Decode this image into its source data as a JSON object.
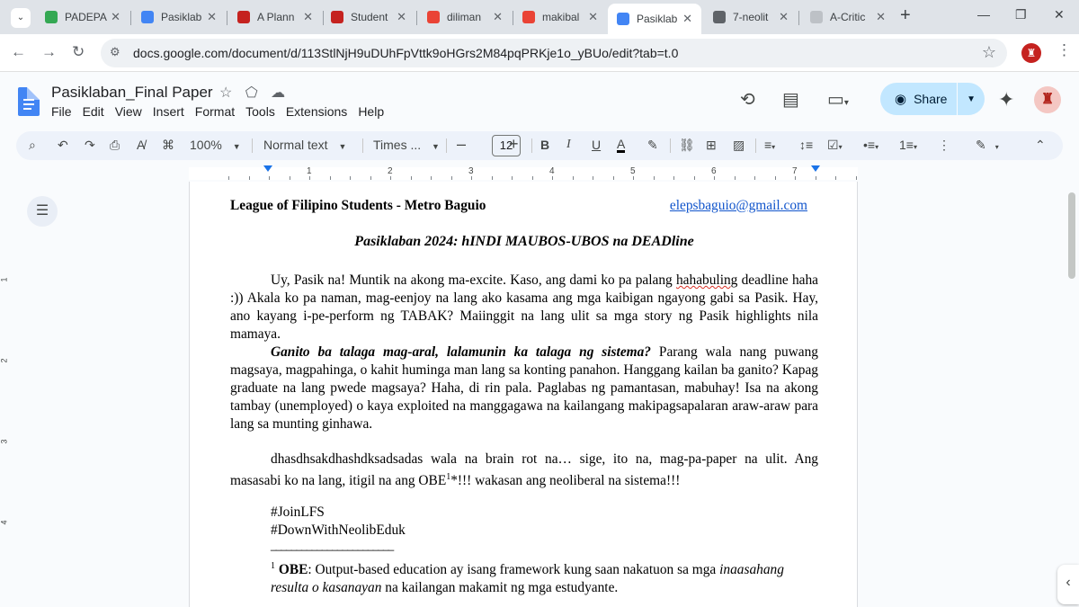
{
  "browser": {
    "tabs": [
      {
        "title": "PADEPA",
        "favicon_color": "#34a853"
      },
      {
        "title": "Pasiklab",
        "favicon_color": "#4285f4"
      },
      {
        "title": "A Plann",
        "favicon_color": "#c5221f"
      },
      {
        "title": "Student",
        "favicon_color": "#c5221f"
      },
      {
        "title": "diliman",
        "favicon_color": "#ea4335"
      },
      {
        "title": "makibal",
        "favicon_color": "#ea4335"
      },
      {
        "title": "Pasiklab",
        "favicon_color": "#4285f4"
      },
      {
        "title": "7-neolit",
        "favicon_color": "#5f6368"
      },
      {
        "title": "A-Critic",
        "favicon_color": "#bdc1c6"
      }
    ],
    "url": "docs.google.com/document/d/113StlNjH9uDUhFpVttk9oHGrs2M84pqPRKje1o_yBUo/edit?tab=t.0"
  },
  "docs": {
    "title": "Pasiklaban_Final Paper",
    "menu": [
      "File",
      "Edit",
      "View",
      "Insert",
      "Format",
      "Tools",
      "Extensions",
      "Help"
    ],
    "share_label": "Share",
    "toolbar": {
      "zoom": "100%",
      "style": "Normal text",
      "font": "Times ...",
      "font_size": "12"
    },
    "ruler_numbers": [
      "1",
      "2",
      "3",
      "4",
      "5",
      "6",
      "7"
    ],
    "vruler_numbers": [
      "1",
      "2",
      "3",
      "4"
    ]
  },
  "document": {
    "org": "League of Filipino Students - Metro Baguio",
    "email": "elepsbaguio@gmail.com",
    "heading": "Pasiklaban 2024: hINDI MAUBOS-UBOS na DEADline",
    "p1_before": "Uy, Pasik na! Muntik na akong ma-excite. Kaso, ang dami ko pa palang ",
    "p1_spell": "hahabuling",
    "p1_after": " deadline haha :)) Akala ko pa naman, mag-eenjoy na lang ako kasama ang mga kaibigan ngayong gabi sa Pasik. Hay, ano kayang i-pe-perform ng TABAK? Maiinggit na lang ulit sa mga story ng Pasik highlights nila mamaya.",
    "p2_bold": "Ganito ba talaga mag-aral, lalamunin ka talaga ng sistema?",
    "p2_rest": " Parang wala nang puwang magsaya, magpahinga, o kahit huminga man lang sa konting panahon. Hanggang kailan ba ganito? Kapag graduate na lang pwede magsaya? Haha, di rin pala. Paglabas ng pamantasan, mabuhay! Isa na akong tambay (unemployed) o kaya exploited na manggagawa na kailangang makipagsapalaran araw-araw para lang sa munting ginhawa.",
    "p3_a": "dhasdhsakdhashdksadsadas wala na brain rot na…  sige, ito na, mag-pa-paper na ulit. Ang masasabi ko na lang, itigil na ang OBE",
    "p3_sup": "1",
    "p3_b": "*!!! wakasan ang neoliberal na sistema!!!",
    "hashtag1": "#JoinLFS",
    "hashtag2": "#DownWithNeolibEduk",
    "footnote_rule": "________________________",
    "fn_num": "1",
    "fn_term": "OBE",
    "fn_a": ": Output-based education ay isang framework kung saan nakatuon sa mga ",
    "fn_italic": "inaasahang resulta o kasanayan",
    "fn_b": " na kailangan makamit ng mga estudyante."
  }
}
